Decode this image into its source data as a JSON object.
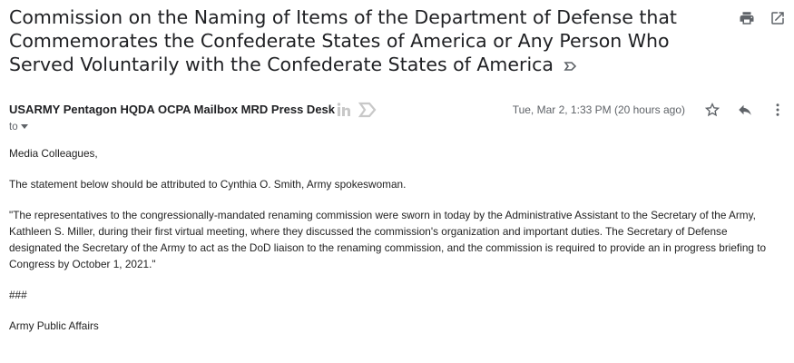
{
  "email": {
    "subject": "Commission on the Naming of Items of the Department of Defense that Commemorates the Confederate States of America or Any Person Who Served Voluntarily with the Confederate States of America",
    "sender": "USARMY Pentagon HQDA OCPA Mailbox MRD Press Desk",
    "date": "Tue, Mar 2, 1:33 PM (20 hours ago)",
    "to_label": "to",
    "body": {
      "greeting": "Media Colleagues,",
      "p1": "The statement below should be attributed to Cynthia O. Smith, Army spokeswoman.",
      "p2": "\"The representatives to the congressionally-mandated renaming commission were sworn in today by the Administrative Assistant to the Secretary of the Army, Kathleen S. Miller, during their first virtual meeting, where they discussed the commission's organization and important duties. The Secretary of Defense designated the Secretary of the Army to act as the DoD liaison to the renaming commission, and the commission is required to provide an in progress briefing to Congress by October 1, 2021.\"",
      "separator": "###",
      "signature": "Army Public Affairs"
    }
  },
  "icons": {
    "print": "printer-icon",
    "open_new_window": "open-in-new-window-icon",
    "importance": "importance-marker-icon",
    "linkedin": "linkedin-icon",
    "star": "star-icon",
    "reply": "reply-icon",
    "more": "more-vert-icon",
    "dropdown": "caret-down-icon"
  },
  "colors": {
    "text": "#202124",
    "muted": "#5f6368",
    "icon_gray": "#c8c8c8"
  }
}
